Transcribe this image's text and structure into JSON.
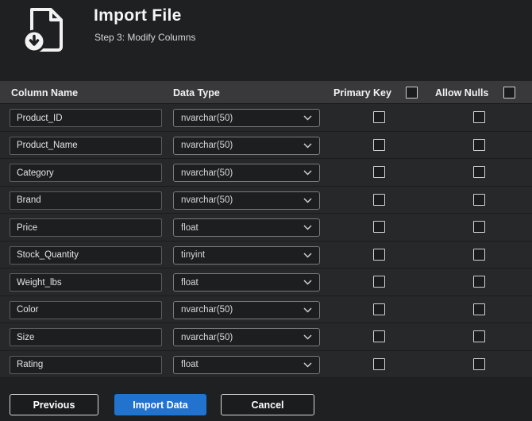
{
  "header": {
    "title": "Import File",
    "subtitle": "Step 3: Modify Columns"
  },
  "table": {
    "headers": {
      "column_name": "Column Name",
      "data_type": "Data Type",
      "primary_key": "Primary Key",
      "allow_nulls": "Allow Nulls"
    },
    "rows": [
      {
        "name": "Product_ID",
        "type": "nvarchar(50)"
      },
      {
        "name": "Product_Name",
        "type": "nvarchar(50)"
      },
      {
        "name": "Category",
        "type": "nvarchar(50)"
      },
      {
        "name": "Brand",
        "type": "nvarchar(50)"
      },
      {
        "name": "Price",
        "type": "float"
      },
      {
        "name": "Stock_Quantity",
        "type": "tinyint"
      },
      {
        "name": "Weight_lbs",
        "type": "float"
      },
      {
        "name": "Color",
        "type": "nvarchar(50)"
      },
      {
        "name": "Size",
        "type": "nvarchar(50)"
      },
      {
        "name": "Rating",
        "type": "float"
      }
    ],
    "checkbox_states": {
      "primary_key_all": false,
      "allow_nulls_all": false
    }
  },
  "footer": {
    "previous_label": "Previous",
    "import_label": "Import Data",
    "cancel_label": "Cancel"
  },
  "colors": {
    "accent_blue": "#2273ce",
    "background": "#1f2022",
    "header_strip": "#39393b"
  }
}
